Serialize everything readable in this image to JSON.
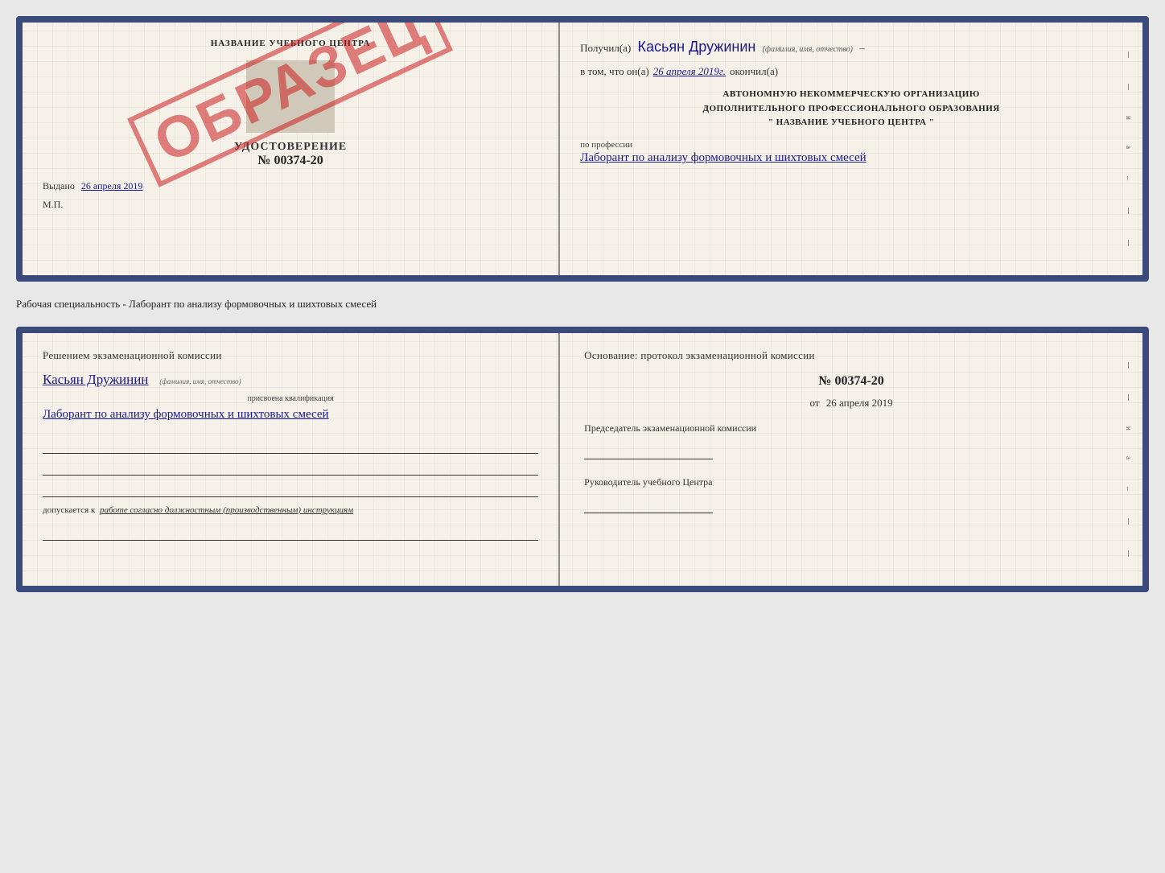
{
  "page": {
    "background_color": "#e8e8e8"
  },
  "top_cert": {
    "left": {
      "title": "НАЗВАНИЕ УЧЕБНОГО ЦЕНТРА",
      "cert_label": "УДОСТОВЕРЕНИЕ",
      "cert_num": "№ 00374-20",
      "vydano_prefix": "Выдано",
      "vydano_date": "26 апреля 2019",
      "mp_label": "М.П.",
      "stamp_text": "ОБРАЗЕЦ"
    },
    "right": {
      "poluchil_prefix": "Получил(а)",
      "poluchil_name": "Касьян Дружинин",
      "name_subtitle": "(фамилия, имя, отчество)",
      "vtom_prefix": "в том, что он(а)",
      "vtom_date": "26 апреля 2019г.",
      "okochil_suffix": "окончил(а)",
      "org_line1": "АВТОНОМНУЮ НЕКОММЕРЧЕСКУЮ ОРГАНИЗАЦИЮ",
      "org_line2": "ДОПОЛНИТЕЛЬНОГО ПРОФЕССИОНАЛЬНОГО ОБРАЗОВАНИЯ",
      "org_line3": "\"  НАЗВАНИЕ УЧЕБНОГО ЦЕНТРА  \"",
      "profess_label": "по профессии",
      "profess_value": "Лаборант по анализу формовочных и шихтовых смесей"
    }
  },
  "separator": {
    "text": "Рабочая специальность - Лаборант по анализу формовочных и шихтовых смесей"
  },
  "bottom_cert": {
    "left": {
      "resheniy_title": "Решением экзаменационной комиссии",
      "name": "Касьян Дружинин",
      "name_subtitle": "(фамилия, имя, отчество)",
      "prisvoena_label": "присвоена квалификация",
      "kvalif_value": "Лаборант по анализу формовочных и шихтовых смесей",
      "dopusk_prefix": "допускается к",
      "dopusk_italic": "работе согласно должностным (производственным) инструкциям"
    },
    "right": {
      "osnovaniye_title": "Основание: протокол экзаменационной комиссии",
      "protocol_num": "№ 00374-20",
      "ot_prefix": "от",
      "ot_date": "26 апреля 2019",
      "predsedatel_title": "Председатель экзаменационной комиссии",
      "rukovoditel_title": "Руководитель учебного Центра"
    }
  },
  "right_edge": {
    "labels": [
      "–",
      "–",
      "и",
      "а",
      "←",
      "–",
      "–"
    ]
  }
}
